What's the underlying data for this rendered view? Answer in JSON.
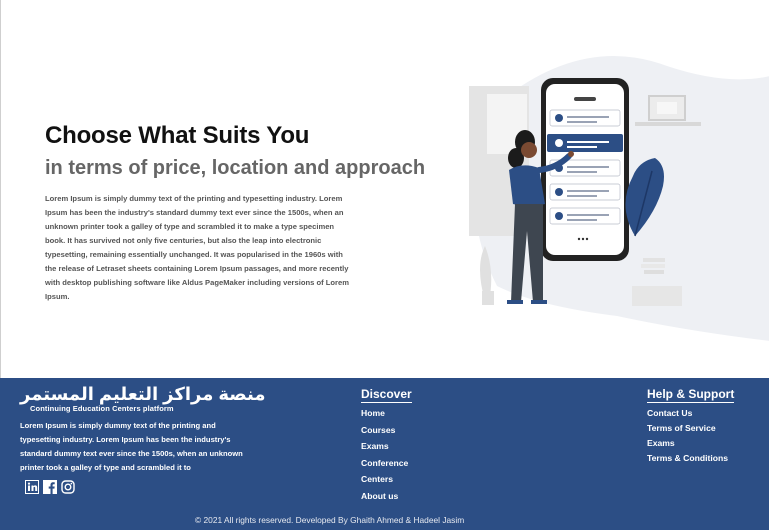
{
  "hero": {
    "title": "Choose What Suits You",
    "subtitle": "in terms of price, location and approach",
    "body": "Lorem Ipsum is simply dummy text of the printing and typesetting industry. Lorem Ipsum has been the industry's standard dummy text ever since the 1500s, when an unknown printer took a galley of type and scrambled it to make a type specimen book. It has survived not only five centuries, but also the leap into electronic typesetting, remaining essentially unchanged. It was popularised in the 1960s with the release of Letraset sheets containing Lorem Ipsum passages, and more recently with desktop publishing software like Aldus PageMaker including versions of Lorem Ipsum."
  },
  "footer": {
    "logo_arabic": "منصة مراكز التعليم المستمر",
    "logo_english": "Continuing Education Centers platform",
    "about": "Lorem Ipsum is simply dummy text of the printing and typesetting industry. Lorem Ipsum has been the industry's standard dummy text ever since the 1500s, when an unknown printer took a galley of type and scrambled it to",
    "social": [
      {
        "icon": "linkedin-icon"
      },
      {
        "icon": "facebook-icon"
      },
      {
        "icon": "instagram-icon"
      }
    ],
    "discover": {
      "title": "Discover",
      "items": [
        "Home",
        "Courses",
        "Exams",
        "Conference",
        "Centers",
        "About us"
      ]
    },
    "help": {
      "title": "Help & Support",
      "items": [
        "Contact Us",
        "Terms of Service",
        "Exams",
        "Terms & Conditions"
      ]
    },
    "copyright": "© 2021 All rights reserved. Developed By Ghaith Ahmed & Hadeel Jasim"
  },
  "colors": {
    "footer_bg": "#2c4e85",
    "accent": "#2c4e85",
    "heading": "#111111",
    "subheading": "#666666"
  }
}
